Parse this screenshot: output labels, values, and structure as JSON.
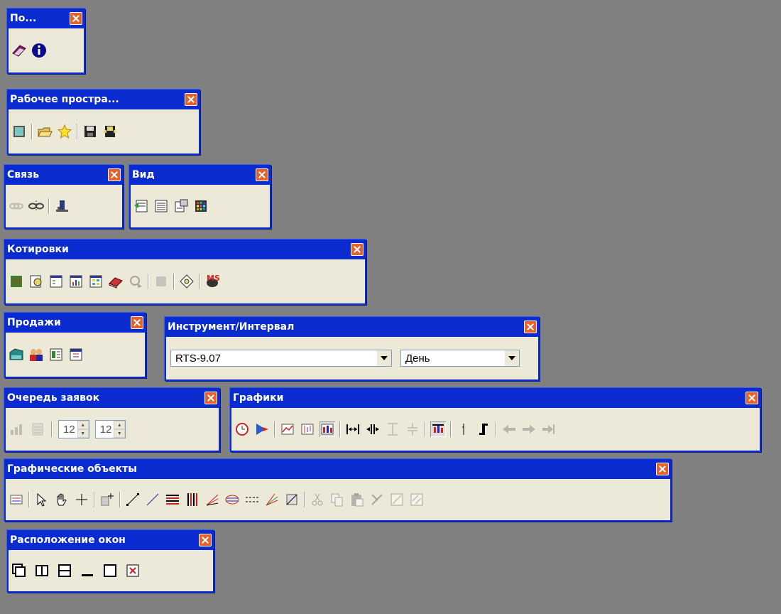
{
  "toolbars": {
    "help": {
      "title": "По..."
    },
    "workspace": {
      "title": "Рабочее простра..."
    },
    "connection": {
      "title": "Связь"
    },
    "view": {
      "title": "Вид"
    },
    "quotes": {
      "title": "Котировки"
    },
    "sales": {
      "title": "Продажи"
    },
    "instrument": {
      "title": "Инструмент/Интервал",
      "instrument_value": "RTS-9.07",
      "interval_value": "День"
    },
    "order_queue": {
      "title": "Очередь заявок",
      "spin1_value": "12",
      "spin2_value": "12"
    },
    "charts": {
      "title": "Графики"
    },
    "graphic_objects": {
      "title": "Графические объекты"
    },
    "window_layout": {
      "title": "Расположение окон"
    }
  },
  "colors": {
    "titlebar": "#0a2bd0",
    "body": "#ece9d8",
    "background": "#808080",
    "close": "#e8602c"
  }
}
